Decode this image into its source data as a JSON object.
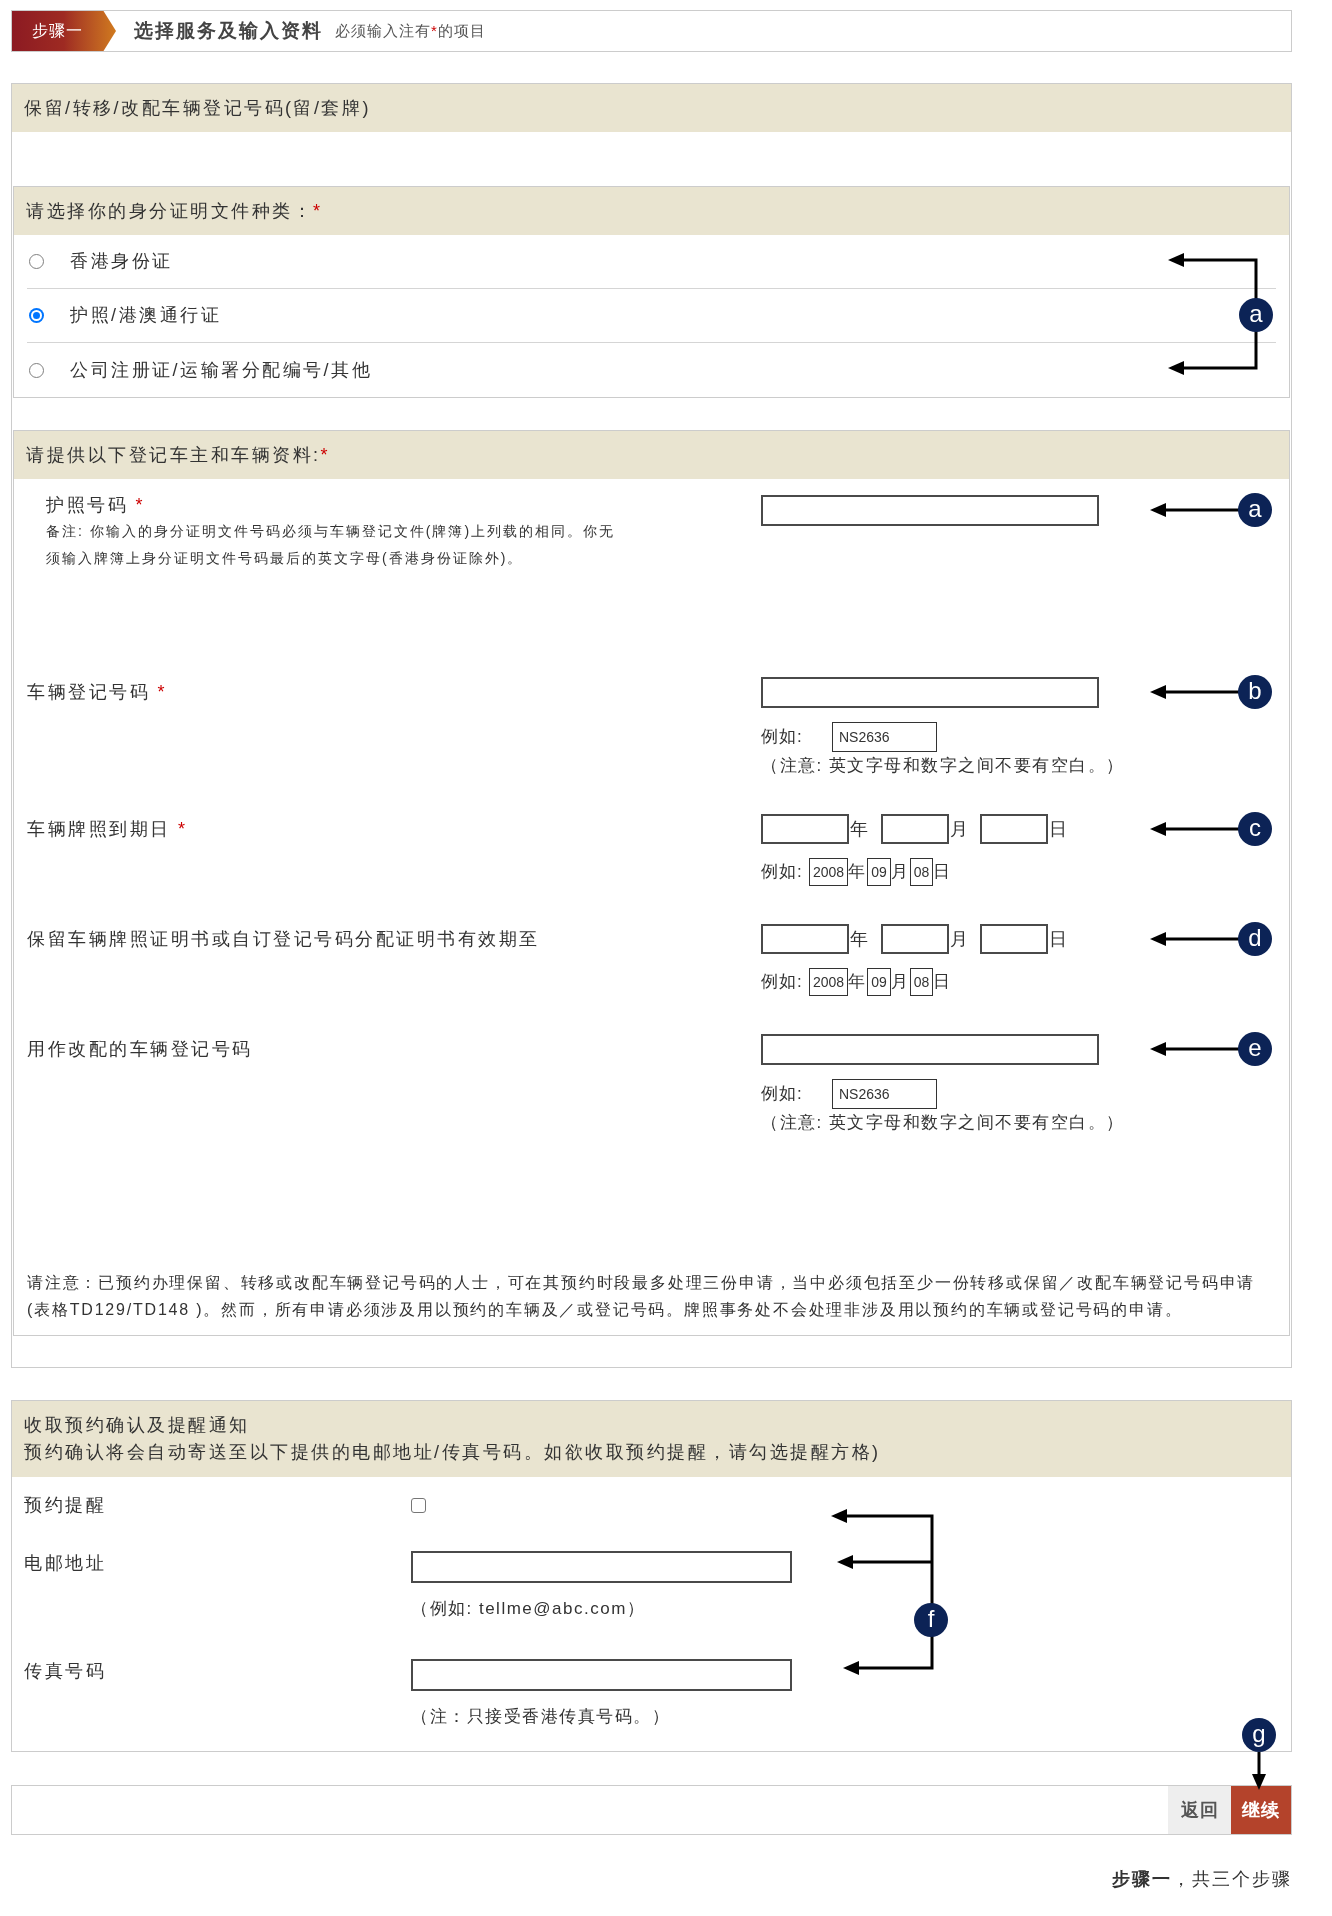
{
  "step_header": {
    "step": "步骤一",
    "title": "选择服务及输入资料",
    "hint": {
      "before": "必须输入注有",
      "mark": "*",
      "after": "的项目"
    }
  },
  "service_panel": {
    "title": "保留/转移/改配车辆登记号码(留/套牌)",
    "id_type": {
      "title": "请选择你的身分证明文件种类：",
      "required_mark": "*",
      "callout": "a",
      "options": [
        {
          "label": "香港身份证",
          "selected": false
        },
        {
          "label": "护照/港澳通行证",
          "selected": true
        },
        {
          "label": "公司注册证/运输署分配编号/其他",
          "selected": false
        }
      ]
    },
    "owner_info": {
      "title": "请提供以下登记车主和车辆资料:",
      "required_mark": "*",
      "fields": [
        {
          "kind": "text",
          "label": "护照号码",
          "required_mark": "*",
          "note": "备注: 你输入的身分证明文件号码必须与车辆登记文件(牌簿)上列载的相同。你无须输入牌簿上身分证明文件号码最后的英文字母(香港身份证除外)。",
          "callout": "a"
        },
        {
          "kind": "text",
          "label": "车辆登记号码",
          "required_mark": "*",
          "example_label": "例如:",
          "example": "NS2636",
          "hint": "（注意: 英文字母和数字之间不要有空白。）",
          "callout": "b"
        },
        {
          "kind": "date",
          "label": "车辆牌照到期日",
          "required_mark": "*",
          "units": [
            "年",
            "月",
            "日"
          ],
          "example_label": "例如:",
          "example": [
            {
              "value": "2008",
              "unit": "年"
            },
            {
              "value": "09",
              "unit": "月"
            },
            {
              "value": "08",
              "unit": "日"
            }
          ],
          "callout": "c"
        },
        {
          "kind": "date",
          "label": "保留车辆牌照证明书或自订登记号码分配证明书有效期至",
          "units": [
            "年",
            "月",
            "日"
          ],
          "example_label": "例如:",
          "example": [
            {
              "value": "2008",
              "unit": "年"
            },
            {
              "value": "09",
              "unit": "月"
            },
            {
              "value": "08",
              "unit": "日"
            }
          ],
          "callout": "d"
        },
        {
          "kind": "text",
          "label": "用作改配的车辆登记号码",
          "example_label": "例如:",
          "example": "NS2636",
          "hint": "（注意: 英文字母和数字之间不要有空白。）",
          "callout": "e"
        }
      ],
      "notice": "请注意：已预约办理保留、转移或改配车辆登记号码的人士，可在其预约时段最多处理三份申请，当中必须包括至少一份转移或保留／改配车辆登记号码申请(表格TD129/TD148 )。然而，所有申请必须涉及用以预约的车辆及／或登记号码。牌照事务处不会处理非涉及用以预约的车辆或登记号码的申请。"
    }
  },
  "notification_panel": {
    "title": "收取预约确认及提醒通知",
    "subtitle": "预约确认将会自动寄送至以下提供的电邮地址/传真号码。如欲收取预约提醒，请勾选提醒方格)",
    "callout": "f",
    "rows": [
      {
        "kind": "checkbox",
        "label": "预约提醒",
        "checked": false
      },
      {
        "kind": "text",
        "label": "电邮地址",
        "hint": "（例如: tellme@abc.com）"
      },
      {
        "kind": "text",
        "label": "传真号码",
        "hint": "（注：只接受香港传真号码。）"
      }
    ]
  },
  "actions": {
    "callout": "g",
    "buttons": [
      {
        "label": "返回",
        "kind": "secondary"
      },
      {
        "label": "继续",
        "kind": "primary"
      }
    ]
  },
  "footer": "**步骤一**，共三个步骤"
}
